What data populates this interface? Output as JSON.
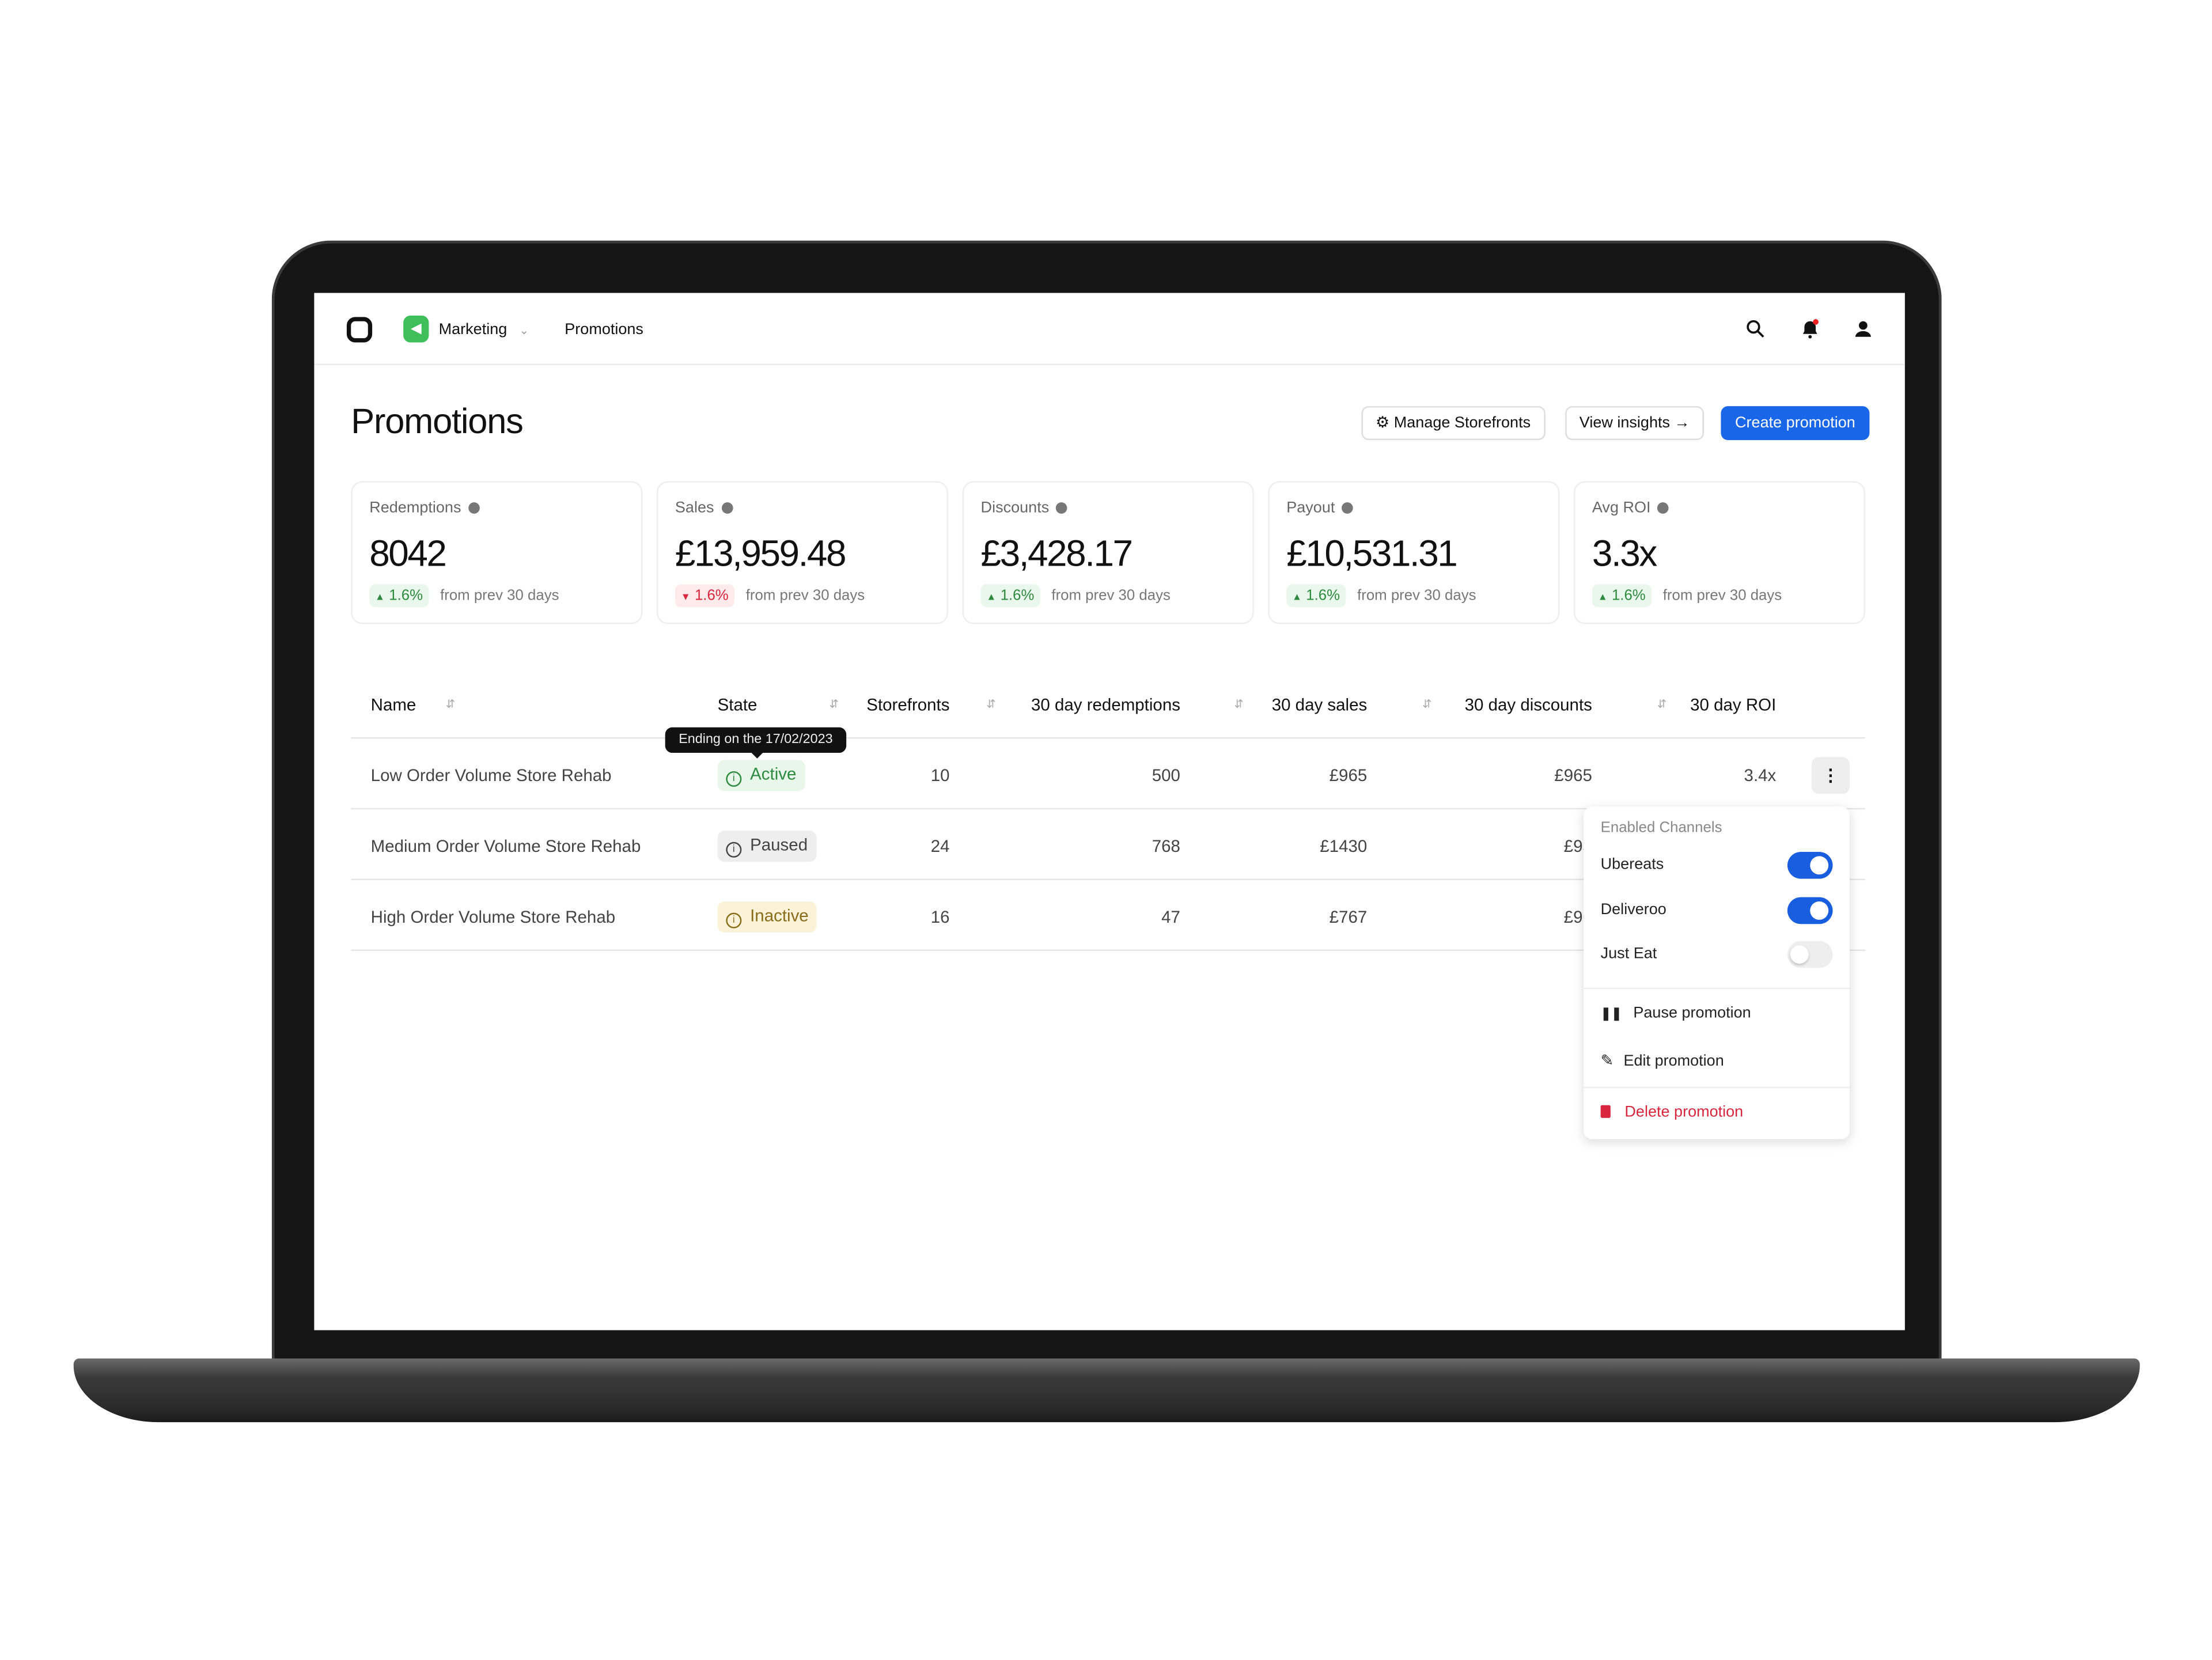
{
  "nav": {
    "app": "Marketing",
    "breadcrumb": "Promotions"
  },
  "page": {
    "title": "Promotions",
    "manage_label": "Manage Storefronts",
    "insights_label": "View insights",
    "create_label": "Create promotion",
    "accent": "#1a66e8"
  },
  "stats": [
    {
      "label": "Redemptions",
      "value": "8042",
      "change": "1.6%",
      "direction": "up",
      "note": "from prev 30 days"
    },
    {
      "label": "Sales",
      "value": "£13,959.48",
      "change": "1.6%",
      "direction": "down",
      "note": "from prev 30 days"
    },
    {
      "label": "Discounts",
      "value": "£3,428.17",
      "change": "1.6%",
      "direction": "up",
      "note": "from prev 30 days"
    },
    {
      "label": "Payout",
      "value": "£10,531.31",
      "change": "1.6%",
      "direction": "up",
      "note": "from prev 30 days"
    },
    {
      "label": "Avg ROI",
      "value": "3.3x",
      "change": "1.6%",
      "direction": "up",
      "note": "from prev 30 days"
    }
  ],
  "table": {
    "headers": [
      "Name",
      "State",
      "Storefronts",
      "30 day redemptions",
      "30 day sales",
      "30 day discounts",
      "30 day ROI"
    ],
    "rows": [
      {
        "name": "Low Order Volume Store Rehab",
        "state": "Active",
        "storefronts": "10",
        "redemptions": "500",
        "sales": "£965",
        "discounts": "£965",
        "roi": "3.4x"
      },
      {
        "name": "Medium Order Volume Store Rehab",
        "state": "Paused",
        "storefronts": "24",
        "redemptions": "768",
        "sales": "£1430",
        "discounts": "£93",
        "roi": ""
      },
      {
        "name": "High Order Volume Store Rehab",
        "state": "Inactive",
        "storefronts": "16",
        "redemptions": "47",
        "sales": "£767",
        "discounts": "£96",
        "roi": ""
      }
    ],
    "tooltip": "Ending on the 17/02/2023"
  },
  "menu": {
    "section": "Enabled Channels",
    "channels": [
      {
        "label": "Ubereats",
        "enabled": true
      },
      {
        "label": "Deliveroo",
        "enabled": true
      },
      {
        "label": "Just Eat",
        "enabled": false
      }
    ],
    "pause": "Pause promotion",
    "edit": "Edit promotion",
    "delete": "Delete promotion"
  }
}
